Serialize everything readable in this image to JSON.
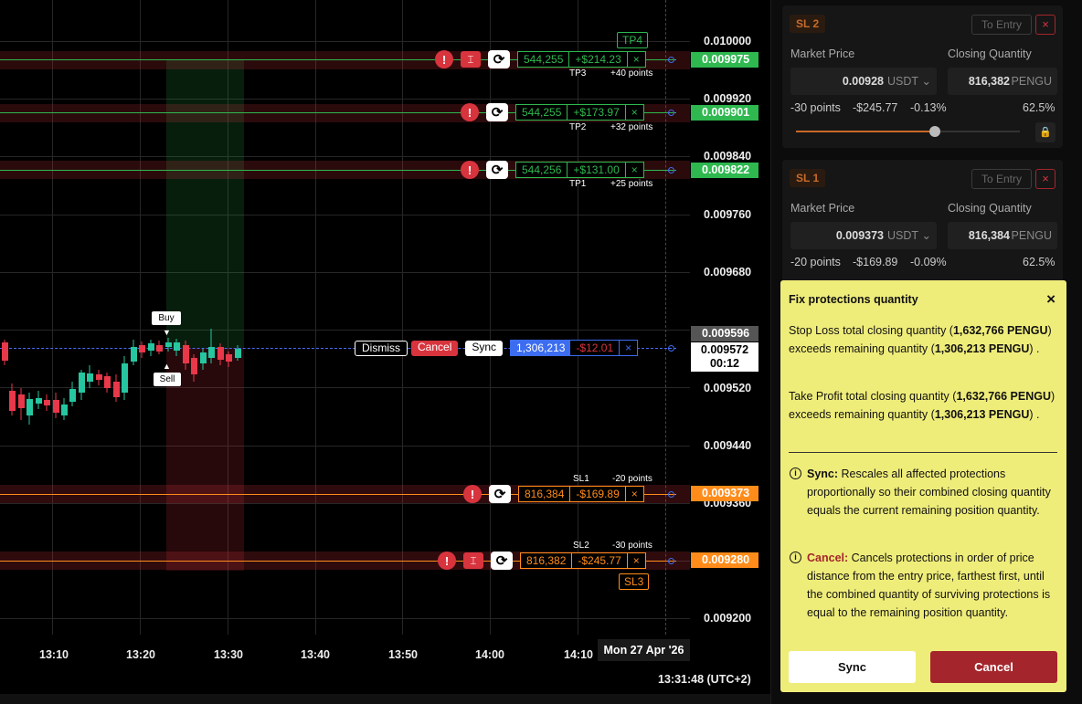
{
  "price_axis": {
    "ticks": [
      "0.010000",
      "0.009920",
      "0.009840",
      "0.009760",
      "0.009680",
      "0.009520",
      "0.009440",
      "0.009360",
      "0.009200"
    ],
    "current_price": "0.009572",
    "countdown": "00:12",
    "marker_price": "0.009596"
  },
  "time_axis": {
    "ticks": [
      "13:10",
      "13:20",
      "13:30",
      "13:40",
      "13:50",
      "14:00",
      "14:10"
    ],
    "date_label": "Mon 27 Apr '26",
    "clock": "13:31:48 (UTC+2)"
  },
  "take_profits": [
    {
      "name": "TP3",
      "qty": "544,255",
      "pnl": "+$214.23",
      "points": "+40 points",
      "price": "0.009975"
    },
    {
      "name": "TP2",
      "qty": "544,255",
      "pnl": "+$173.97",
      "points": "+32 points",
      "price": "0.009901"
    },
    {
      "name": "TP1",
      "qty": "544,256",
      "pnl": "+$131.00",
      "points": "+25 points",
      "price": "0.009822"
    }
  ],
  "tp4_label": "TP4",
  "stop_losses": [
    {
      "name": "SL1",
      "qty": "816,384",
      "pnl": "-$169.89",
      "points": "-20 points",
      "price": "0.009373"
    },
    {
      "name": "SL2",
      "qty": "816,382",
      "pnl": "-$245.77",
      "points": "-30 points",
      "price": "0.009280"
    }
  ],
  "sl3_label": "SL3",
  "position": {
    "qty": "1,306,213",
    "pnl": "-$12.01",
    "dismiss": "Dismiss",
    "cancel": "Cancel",
    "sync": "Sync"
  },
  "markers": {
    "buy": "Buy",
    "sell": "Sell"
  },
  "icons": {
    "close": "×",
    "bang": "!",
    "sync": "⟳",
    "range": "⌶"
  },
  "colors": {
    "tp": "#2eb84f",
    "sl": "#ff8c1a",
    "loss": "#d8343e",
    "accent": "#3c6df0"
  },
  "side": {
    "cards": [
      {
        "tag": "SL 2",
        "to_entry": "To Entry",
        "market_price_label": "Market Price",
        "closing_qty_label": "Closing Quantity",
        "price": "0.00928",
        "price_unit": "USDT",
        "qty": "816,382",
        "qty_unit": "PENGU",
        "points": "-30 points",
        "pnl": "-$245.77",
        "pct": "-0.13%",
        "share": "62.5%"
      },
      {
        "tag": "SL 1",
        "to_entry": "To Entry",
        "market_price_label": "Market Price",
        "closing_qty_label": "Closing Quantity",
        "price": "0.009373",
        "price_unit": "USDT",
        "qty": "816,384",
        "qty_unit": "PENGU",
        "points": "-20 points",
        "pnl": "-$169.89",
        "pct": "-0.09%",
        "share": "62.5%"
      }
    ]
  },
  "popup": {
    "title": "Fix protections quantity",
    "sl_text_1": "Stop Loss total closing quantity (",
    "sl_qty": "1,632,766 PENGU",
    "sl_text_2": ") exceeds remaining quantity (",
    "remaining": "1,306,213 PENGU",
    "end": ") .",
    "tp_text_1": "Take Profit total closing quantity (",
    "tp_qty": "1,632,766 PENGU",
    "sync_head": "Sync:",
    "sync_desc": "Rescales all affected protections proportionally so their combined closing quantity equals the current remaining position quantity.",
    "cancel_head": "Cancel:",
    "cancel_desc": "Cancels protections in order of price distance from the entry price, farthest first, until the combined quantity of surviving protections is equal to the remaining position quantity.",
    "sync_btn": "Sync",
    "cancel_btn": "Cancel"
  }
}
